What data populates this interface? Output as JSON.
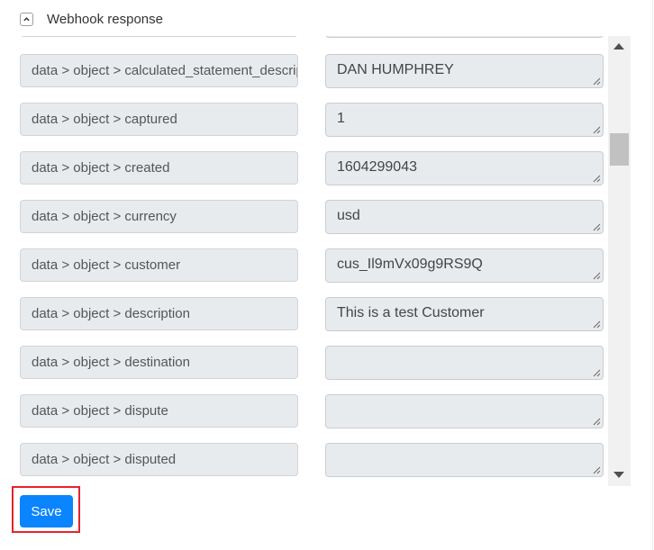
{
  "section": {
    "title": "Webhook response",
    "collapse_icon": "chevron-up-icon"
  },
  "fields": [
    {
      "key": "",
      "value": ""
    },
    {
      "key": "data > object > calculated_statement_descriptor",
      "value": "DAN HUMPHREY"
    },
    {
      "key": "data > object > captured",
      "value": "1"
    },
    {
      "key": "data > object > created",
      "value": "1604299043"
    },
    {
      "key": "data > object > currency",
      "value": "usd"
    },
    {
      "key": "data > object > customer",
      "value": "cus_Il9mVx09g9RS9Q"
    },
    {
      "key": "data > object > description",
      "value": "This is a test Customer"
    },
    {
      "key": "data > object > destination",
      "value": ""
    },
    {
      "key": "data > object > dispute",
      "value": ""
    },
    {
      "key": "data > object > disputed",
      "value": ""
    }
  ],
  "scrollbar": {
    "up_icon": "arrow-up-icon",
    "down_icon": "arrow-down-icon"
  },
  "actions": {
    "save_label": "Save",
    "highlight_color": "#e8222a",
    "button_color": "#0a84ff"
  }
}
